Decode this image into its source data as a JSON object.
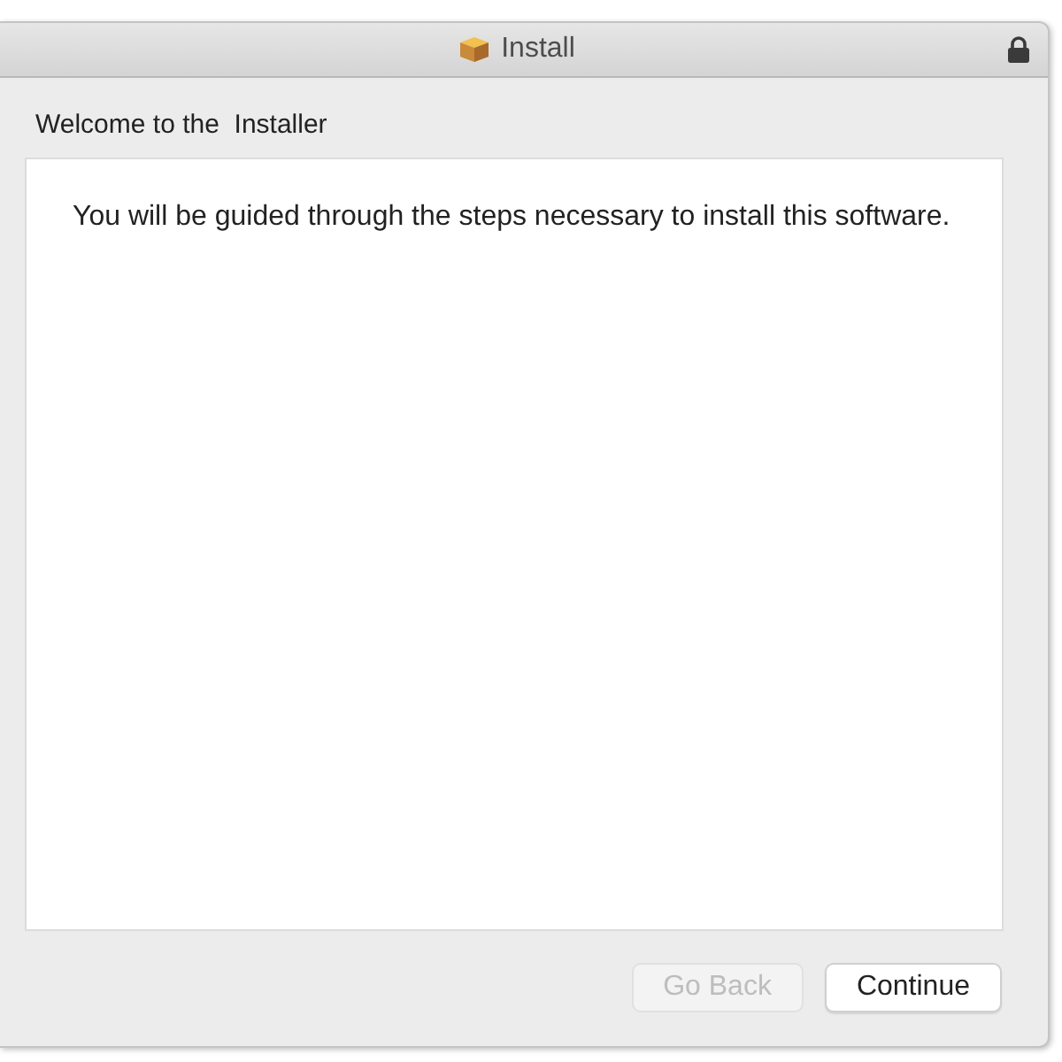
{
  "window": {
    "title": "Install",
    "locked": true
  },
  "heading": "Welcome to the  Installer",
  "body": "You will be guided through the steps necessary to install this software.",
  "buttons": [
    {
      "label": "Go Back",
      "disabled": true
    },
    {
      "label": "Continue",
      "disabled": false
    }
  ]
}
